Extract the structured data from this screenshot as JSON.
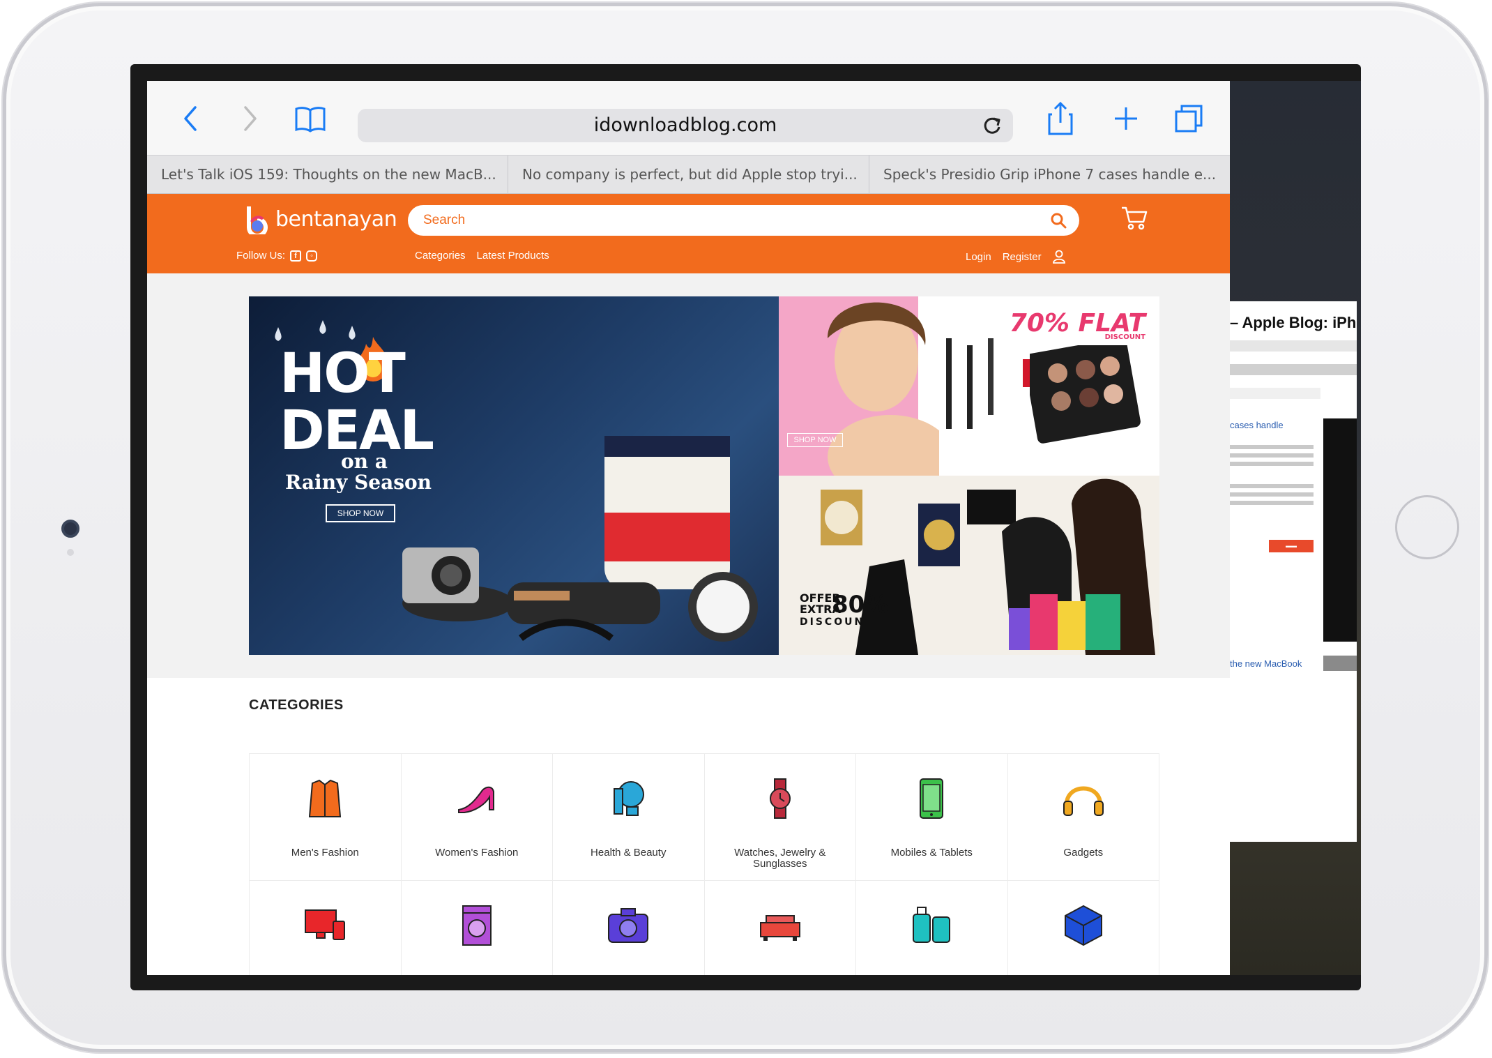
{
  "browser": {
    "url": "idownloadblog.com",
    "tabs": [
      "Let's Talk iOS 159: Thoughts on the new MacB...",
      "No company is perfect, but did Apple stop tryi...",
      "Speck's Presidio Grip iPhone 7 cases handle e..."
    ],
    "side_card_title": "– Apple Blog: iPho",
    "side_card_link": "cases handle",
    "side_card_bottom_link": "the new MacBook"
  },
  "site": {
    "brand": "bentanayan",
    "search_placeholder": "Search",
    "follow_label": "Follow Us:",
    "nav": [
      "Categories",
      "Latest Products"
    ],
    "login": "Login",
    "register": "Register",
    "accent_color": "#f26b1d"
  },
  "banners": {
    "main_line1": "HOT",
    "main_line2": "DEAL",
    "main_line3": "on a",
    "main_line4": "Rainy Season",
    "main_cta": "SHOP NOW",
    "beauty_offer": "70% FLAT",
    "beauty_offer_sub": "DISCOUNT",
    "beauty_cta": "SHOP NOW",
    "fashion_offer_small": "OFFER EXTRA",
    "fashion_offer_big": "80%",
    "fashion_offer_sub": "DISCOUNT"
  },
  "categories": {
    "title": "CATEGORIES",
    "items": [
      {
        "label": "Men's Fashion",
        "icon": "shirt-icon"
      },
      {
        "label": "Women's Fashion",
        "icon": "high-heel-icon"
      },
      {
        "label": "Health & Beauty",
        "icon": "mirror-icon"
      },
      {
        "label": "Watches, Jewelry & Sunglasses",
        "icon": "watch-icon"
      },
      {
        "label": "Mobiles & Tablets",
        "icon": "phone-icon"
      },
      {
        "label": "Gadgets",
        "icon": "headphones-icon"
      },
      {
        "label": "",
        "icon": "computer-icon"
      },
      {
        "label": "",
        "icon": "washing-machine-icon"
      },
      {
        "label": "",
        "icon": "camera-icon"
      },
      {
        "label": "",
        "icon": "sofa-icon"
      },
      {
        "label": "",
        "icon": "luggage-icon"
      },
      {
        "label": "",
        "icon": "toy-block-icon"
      }
    ]
  }
}
